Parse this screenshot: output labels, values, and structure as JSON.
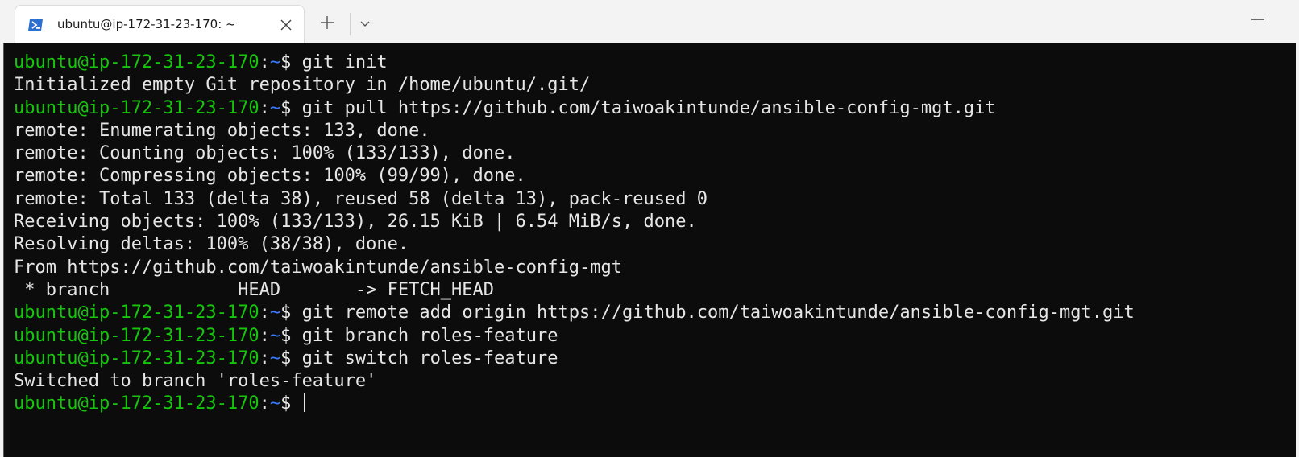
{
  "window": {
    "tab_title": "ubuntu@ip-172-31-23-170: ~",
    "icons": {
      "tab": "powershell-terminal-icon",
      "close": "close-icon",
      "new_tab": "plus-icon",
      "dropdown": "chevron-down-icon",
      "minimize": "minimize-icon"
    }
  },
  "colors": {
    "user": "#16c60c",
    "path": "#3b78ff",
    "text": "#e6e6e6",
    "background": "#0c0c0c"
  },
  "terminal": {
    "prompt": {
      "user": "ubuntu@ip-172-31-23-170",
      "colon": ":",
      "path": "~",
      "symbol": "$ "
    },
    "lines": [
      {
        "type": "cmd",
        "text": "git init"
      },
      {
        "type": "out",
        "text": "Initialized empty Git repository in /home/ubuntu/.git/"
      },
      {
        "type": "cmd",
        "text": "git pull https://github.com/taiwoakintunde/ansible-config-mgt.git"
      },
      {
        "type": "out",
        "text": "remote: Enumerating objects: 133, done."
      },
      {
        "type": "out",
        "text": "remote: Counting objects: 100% (133/133), done."
      },
      {
        "type": "out",
        "text": "remote: Compressing objects: 100% (99/99), done."
      },
      {
        "type": "out",
        "text": "remote: Total 133 (delta 38), reused 58 (delta 13), pack-reused 0"
      },
      {
        "type": "out",
        "text": "Receiving objects: 100% (133/133), 26.15 KiB | 6.54 MiB/s, done."
      },
      {
        "type": "out",
        "text": "Resolving deltas: 100% (38/38), done."
      },
      {
        "type": "out",
        "text": "From https://github.com/taiwoakintunde/ansible-config-mgt"
      },
      {
        "type": "out",
        "text": " * branch            HEAD       -> FETCH_HEAD"
      },
      {
        "type": "cmd",
        "text": "git remote add origin https://github.com/taiwoakintunde/ansible-config-mgt.git"
      },
      {
        "type": "cmd",
        "text": "git branch roles-feature"
      },
      {
        "type": "cmd",
        "text": "git switch roles-feature"
      },
      {
        "type": "out",
        "text": "Switched to branch 'roles-feature'"
      },
      {
        "type": "cmd",
        "text": ""
      }
    ]
  }
}
